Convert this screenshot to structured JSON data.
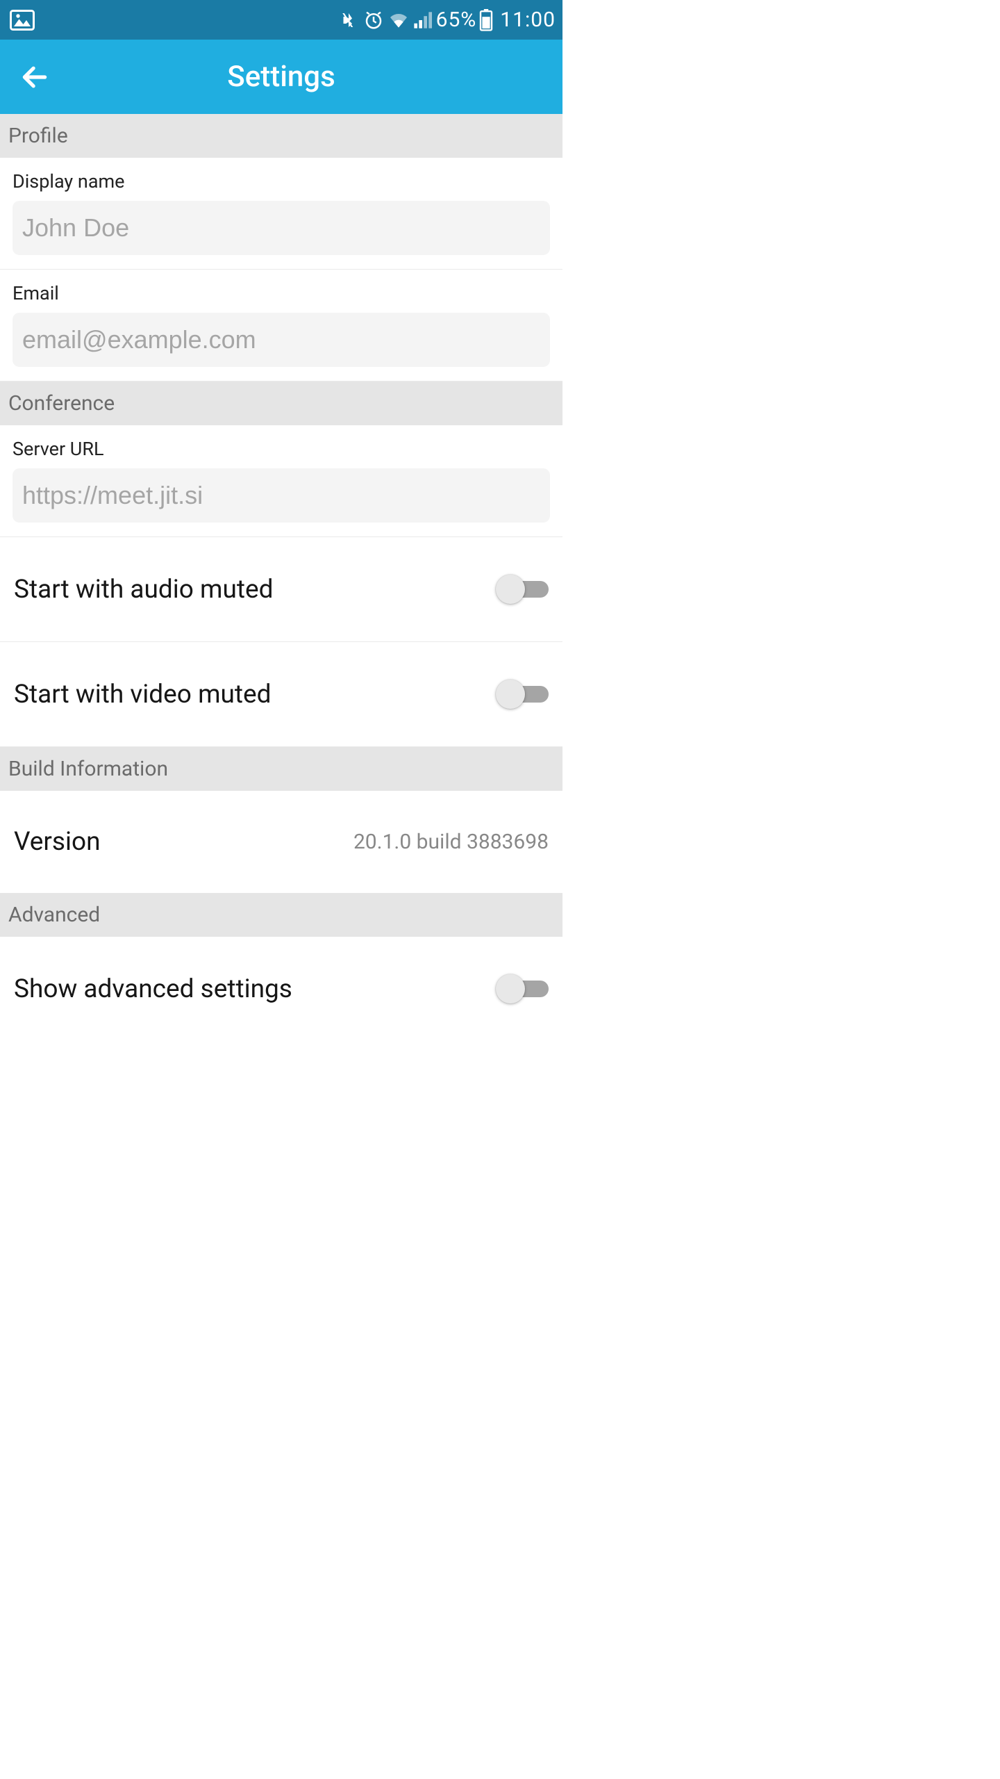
{
  "status": {
    "battery": "65%",
    "time": "11:00"
  },
  "header": {
    "title": "Settings"
  },
  "sections": {
    "profile": {
      "title": "Profile",
      "displayName": {
        "label": "Display name",
        "placeholder": "John Doe",
        "value": ""
      },
      "email": {
        "label": "Email",
        "placeholder": "email@example.com",
        "value": ""
      }
    },
    "conference": {
      "title": "Conference",
      "serverUrl": {
        "label": "Server URL",
        "placeholder": "https://meet.jit.si",
        "value": ""
      },
      "audioMuted": {
        "label": "Start with audio muted",
        "enabled": false
      },
      "videoMuted": {
        "label": "Start with video muted",
        "enabled": false
      }
    },
    "build": {
      "title": "Build Information",
      "version": {
        "label": "Version",
        "value": "20.1.0 build 3883698"
      }
    },
    "advanced": {
      "title": "Advanced",
      "showAdvanced": {
        "label": "Show advanced settings",
        "enabled": false
      }
    }
  }
}
